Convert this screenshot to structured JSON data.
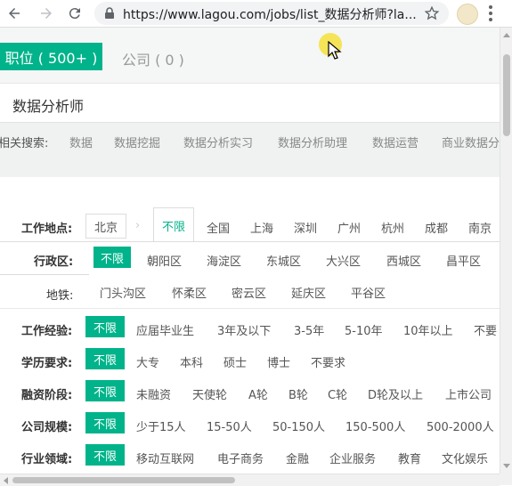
{
  "browser": {
    "url": "https://www.lagou.com/jobs/list_数据分析师?la..."
  },
  "tabs": {
    "positions": "职位 ( 500+ )",
    "companies": "公司 ( 0 )"
  },
  "search": {
    "query": "数据分析师"
  },
  "related": {
    "label": "相关搜索:",
    "keywords": [
      "数据",
      "数据挖掘",
      "数据分析实习",
      "数据分析助理",
      "数据运营",
      "商业数据分"
    ]
  },
  "location": {
    "label": "工作地点:",
    "current_city": "北京",
    "unlimited": "不限",
    "cities": [
      "全国",
      "上海",
      "深圳",
      "广州",
      "杭州",
      "成都",
      "南京"
    ]
  },
  "district": {
    "label": "行政区:",
    "selected": "不限",
    "options": [
      "朝阳区",
      "海淀区",
      "东城区",
      "大兴区",
      "西城区",
      "昌平区"
    ]
  },
  "metro": {
    "label": "地铁:",
    "options": [
      "门头沟区",
      "怀柔区",
      "密云区",
      "延庆区",
      "平谷区"
    ]
  },
  "experience": {
    "label": "工作经验:",
    "selected": "不限",
    "options": [
      "应届毕业生",
      "3年及以下",
      "3-5年",
      "5-10年",
      "10年以上",
      "不要"
    ]
  },
  "education": {
    "label": "学历要求:",
    "selected": "不限",
    "options": [
      "大专",
      "本科",
      "硕士",
      "博士",
      "不要求"
    ]
  },
  "financing": {
    "label": "融资阶段:",
    "selected": "不限",
    "options": [
      "未融资",
      "天使轮",
      "A轮",
      "B轮",
      "C轮",
      "D轮及以上",
      "上市公司"
    ]
  },
  "size": {
    "label": "公司规模:",
    "selected": "不限",
    "options": [
      "少于15人",
      "15-50人",
      "50-150人",
      "150-500人",
      "500-2000人"
    ]
  },
  "industry": {
    "label": "行业领域:",
    "selected": "不限",
    "options": [
      "移动互联网",
      "电子商务",
      "金融",
      "企业服务",
      "教育",
      "文化娱乐"
    ]
  },
  "colors": {
    "accent": "#00b38a"
  }
}
